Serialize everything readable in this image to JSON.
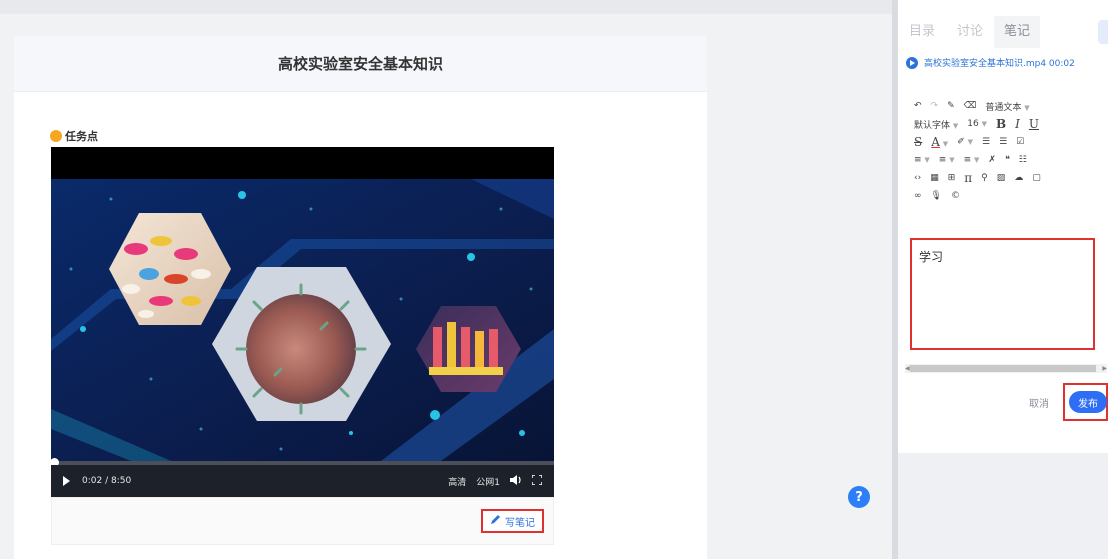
{
  "main": {
    "title": "高校实验室安全基本知识",
    "task_point_label": "任务点"
  },
  "video": {
    "current_time": "0:02",
    "duration": "8:50",
    "time_display": "0:02 / 8:50",
    "quality": "高清",
    "line": "公网1",
    "progress": 0.004
  },
  "note_button": {
    "label": "写笔记"
  },
  "help": {
    "label": "?"
  },
  "side": {
    "tabs": [
      {
        "label": "目录",
        "active": false
      },
      {
        "label": "讨论",
        "active": false
      },
      {
        "label": "笔记",
        "active": true
      }
    ],
    "file_line": "高校实验室安全基本知识.mp4 00:02",
    "toolbar": {
      "paragraph_style": "普通文本",
      "font_family": "默认字体",
      "font_size": "16",
      "bold": "B",
      "italic": "I",
      "underline": "U",
      "strike": "S",
      "font_color": "A"
    },
    "editor_text": "学习",
    "cancel_label": "取消",
    "publish_label": "发布"
  },
  "colors": {
    "accent": "#2d6ef5",
    "highlight_border": "#e03131",
    "link": "#2b73d8"
  }
}
